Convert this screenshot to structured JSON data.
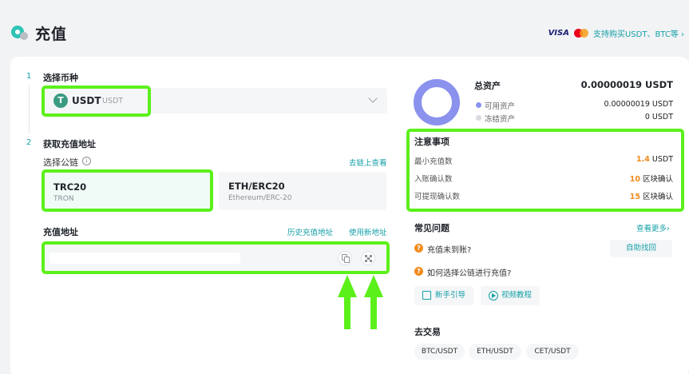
{
  "header": {
    "title": "充值",
    "card_brand": "VISA",
    "buy_link": "支持购买USDT、BTC等 ›"
  },
  "steps": [
    {
      "num": "1",
      "title": "选择币种"
    },
    {
      "num": "2",
      "title": "获取充值地址"
    }
  ],
  "coin_select": {
    "symbol": "USDT",
    "name": "USDT",
    "icon_letter": "T"
  },
  "chain": {
    "label": "选择公链",
    "info_glyph": "i",
    "explorer_link": "去链上查看",
    "options": [
      {
        "name": "TRC20",
        "sub": "TRON",
        "selected": true
      },
      {
        "name": "ETH/ERC20",
        "sub": "Ethereum/ERC-20",
        "selected": false
      }
    ]
  },
  "address": {
    "label": "充值地址",
    "history_link": "历史充值地址",
    "new_link": "使用新地址"
  },
  "assets": {
    "title": "总资产",
    "total": "0.00000019 USDT",
    "available_label": "可用资产",
    "available_value": "0.00000019 USDT",
    "frozen_label": "冻结资产",
    "frozen_value": "0 USDT"
  },
  "notes": {
    "title": "注意事项",
    "min_label": "最小充值数",
    "min_value": "1.4",
    "min_unit": " USDT",
    "arrival_label": "入账确认数",
    "arrival_value": "10",
    "arrival_unit": " 区块确认",
    "withdraw_label": "可提现确认数",
    "withdraw_value": "15",
    "withdraw_unit": " 区块确认"
  },
  "faq": {
    "title": "常见问题",
    "more": "查看更多›",
    "q1": "充值未到账?",
    "q2": "如何选择公链进行充值?",
    "self_help": "自助找回",
    "guide": "新手引导",
    "video": "视频教程"
  },
  "trade": {
    "title": "去交易",
    "pairs": [
      "BTC/USDT",
      "ETH/USDT",
      "CET/USDT"
    ]
  },
  "colors": {
    "accent": "#16a0a8",
    "highlight": "#5cf01a",
    "donut": "#8a92ee",
    "warning": "#f08a1c"
  }
}
